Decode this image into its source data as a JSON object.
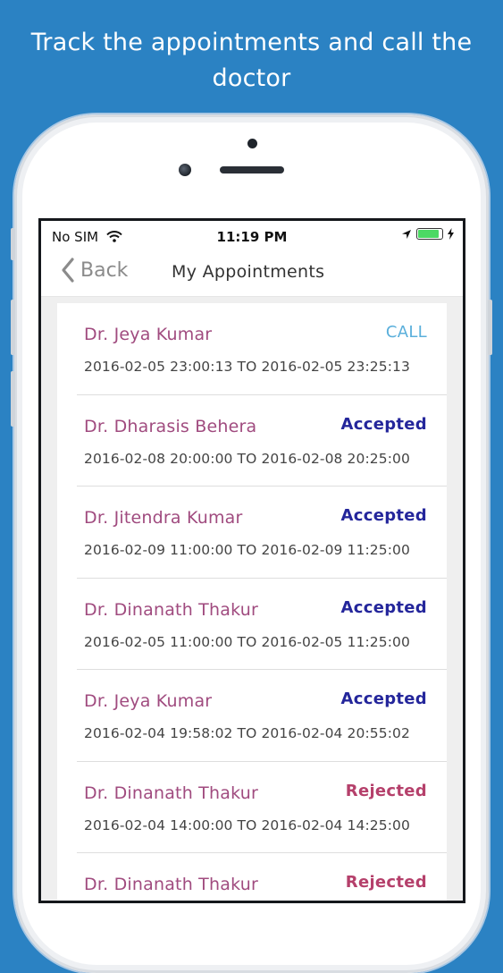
{
  "headline": "Track the appointments and call the doctor",
  "colors": {
    "background": "#2b82c3",
    "doctor_name": "#a04b7f",
    "call": "#5aafdb",
    "accepted": "#24269b",
    "rejected": "#b5406b"
  },
  "status_bar": {
    "carrier": "No SIM",
    "time": "11:19 PM",
    "icons": [
      "wifi-icon",
      "location-arrow-icon",
      "battery-icon",
      "charging-bolt-icon"
    ]
  },
  "nav": {
    "back_label": "Back",
    "back_icon": "chevron-left-icon",
    "title": "My Appointments"
  },
  "appointments": [
    {
      "doctor": "Dr. Jeya Kumar",
      "status": "CALL",
      "kind": "call",
      "time": "2016-02-05 23:00:13 TO 2016-02-05 23:25:13"
    },
    {
      "doctor": "Dr. Dharasis Behera",
      "status": "Accepted",
      "kind": "accepted",
      "time": "2016-02-08 20:00:00 TO 2016-02-08 20:25:00"
    },
    {
      "doctor": "Dr. Jitendra Kumar",
      "status": "Accepted",
      "kind": "accepted",
      "time": "2016-02-09 11:00:00 TO 2016-02-09 11:25:00"
    },
    {
      "doctor": "Dr. Dinanath Thakur",
      "status": "Accepted",
      "kind": "accepted",
      "time": "2016-02-05 11:00:00 TO 2016-02-05 11:25:00"
    },
    {
      "doctor": "Dr. Jeya Kumar",
      "status": "Accepted",
      "kind": "accepted",
      "time": "2016-02-04 19:58:02 TO 2016-02-04 20:55:02"
    },
    {
      "doctor": "Dr. Dinanath Thakur",
      "status": "Rejected",
      "kind": "rejected",
      "time": "2016-02-04 14:00:00 TO 2016-02-04 14:25:00"
    },
    {
      "doctor": "Dr. Dinanath Thakur",
      "status": "Rejected",
      "kind": "rejected",
      "time": ""
    }
  ]
}
